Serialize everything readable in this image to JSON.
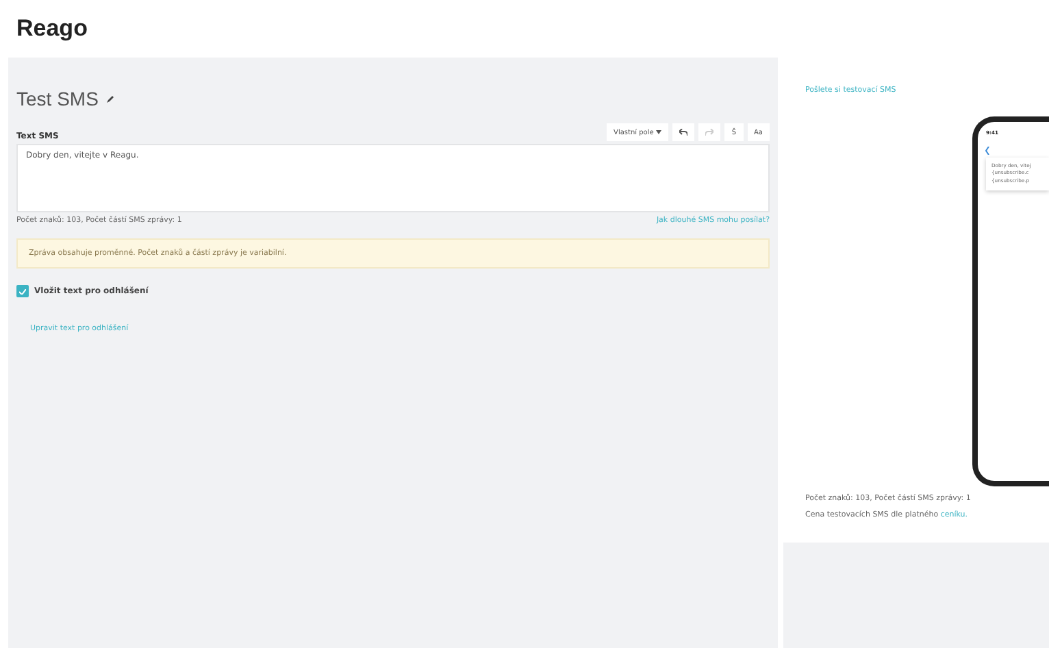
{
  "header": {
    "logo": "Reago"
  },
  "editor": {
    "title": "Test SMS",
    "field_label": "Text SMS",
    "toolbar": [
      {
        "kind": "dropdown",
        "label": "Vlastní pole",
        "disabled": false
      },
      {
        "kind": "undo",
        "disabled": false
      },
      {
        "kind": "redo",
        "disabled": true
      },
      {
        "kind": "text",
        "label": "Š",
        "disabled": false
      },
      {
        "kind": "text",
        "label": "Aa",
        "disabled": false
      }
    ],
    "value": "Dobry den, vitejte v Reagu.",
    "counter": "Počet znaků: 103, Počet částí SMS zprávy: 1",
    "help_link": "Jak dlouhé SMS mohu posílat?",
    "notice": "Zpráva obsahuje proměnné. Počet znaků a částí zprávy je variabilní.",
    "unsubscribe": {
      "label": "Vložit text pro odhlášení",
      "checked": true
    },
    "edit_link": "Upravit text pro odhlášení"
  },
  "preview": {
    "send_link": "Pošlete si testovací SMS",
    "phone": {
      "time": "9:41",
      "message_lines": [
        "Dobry den, vitej",
        "{unsubscribe.c",
        "{unsubscribe.p"
      ]
    },
    "counter": "Počet znaků: 103, Počet částí SMS zprávy: 1",
    "price_text": "Cena testovacích SMS dle platného",
    "price_link": "ceníku."
  }
}
